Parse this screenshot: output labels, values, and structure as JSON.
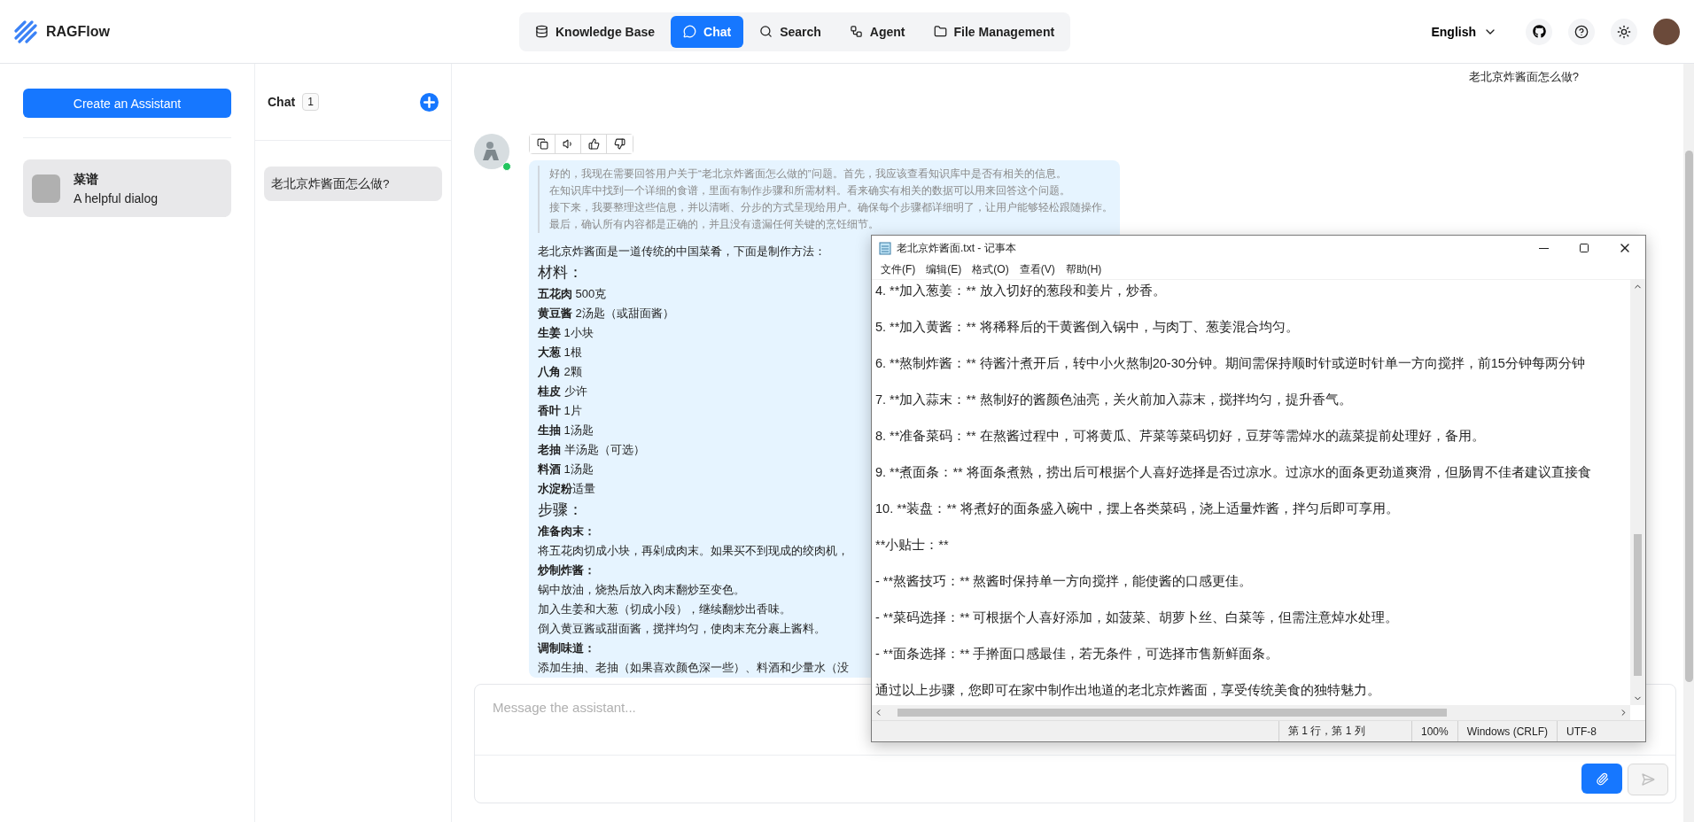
{
  "header": {
    "brand": "RAGFlow",
    "nav": [
      {
        "label": "Knowledge Base",
        "selected": false
      },
      {
        "label": "Chat",
        "selected": true
      },
      {
        "label": "Search",
        "selected": false
      },
      {
        "label": "Agent",
        "selected": false
      },
      {
        "label": "File Management",
        "selected": false
      }
    ],
    "language": "English"
  },
  "assistants_panel": {
    "create_button": "Create an Assistant",
    "assistants": [
      {
        "name": "菜谱",
        "description": "A helpful dialog",
        "selected": true
      }
    ]
  },
  "chats_panel": {
    "title": "Chat",
    "count": "1",
    "conversations": [
      {
        "title": "老北京炸酱面怎么做?",
        "selected": true
      }
    ]
  },
  "conversation": {
    "user_message": "老北京炸酱面怎么做?",
    "assistant": {
      "online": true,
      "thinking": [
        "好的，我现在需要回答用户关于“老北京炸酱面怎么做的”问题。首先，我应该查看知识库中是否有相关的信息。",
        "在知识库中找到一个详细的食谱，里面有制作步骤和所需材料。看来确实有相关的数据可以用来回答这个问题。",
        "接下来，我要整理这些信息，并以清晰、分步的方式呈现给用户。确保每个步骤都详细明了，让用户能够轻松跟随操作。",
        "最后，确认所有内容都是正确的，并且没有遗漏任何关键的烹饪细节。"
      ],
      "answer": [
        {
          "kind": "text",
          "text": "老北京炸酱面是一道传统的中国菜肴，下面是制作方法："
        },
        {
          "kind": "heading",
          "text": "材料："
        },
        {
          "kind": "text",
          "text": "**五花肉** 500克"
        },
        {
          "kind": "text",
          "text": "**黄豆酱** 2汤匙（或甜面酱）"
        },
        {
          "kind": "text",
          "text": "**生姜** 1小块"
        },
        {
          "kind": "text",
          "text": "**大葱** 1根"
        },
        {
          "kind": "text",
          "text": "**八角** 2颗"
        },
        {
          "kind": "text",
          "text": "**桂皮** 少许"
        },
        {
          "kind": "text",
          "text": "**香叶** 1片"
        },
        {
          "kind": "text",
          "text": "**生抽** 1汤匙"
        },
        {
          "kind": "text",
          "text": "**老抽** 半汤匙（可选）"
        },
        {
          "kind": "text",
          "text": "**料酒** 1汤匙"
        },
        {
          "kind": "text",
          "text": "**水淀粉**适量"
        },
        {
          "kind": "heading",
          "text": "步骤："
        },
        {
          "kind": "subheading",
          "text": "准备肉末："
        },
        {
          "kind": "text",
          "text": "将五花肉切成小块，再剁成肉末。如果买不到现成的绞肉机，"
        },
        {
          "kind": "subheading",
          "text": "炒制炸酱："
        },
        {
          "kind": "text",
          "text": "锅中放油，烧热后放入肉末翻炒至变色。"
        },
        {
          "kind": "text",
          "text": "加入生姜和大葱（切成小段），继续翻炒出香味。"
        },
        {
          "kind": "text",
          "text": "倒入黄豆酱或甜面酱，搅拌均匀，使肉末充分裹上酱料。"
        },
        {
          "kind": "subheading",
          "text": "调制味道："
        },
        {
          "kind": "text",
          "text": "添加生抽、老抽（如果喜欢颜色深一些）、料酒和少量水（没"
        }
      ]
    }
  },
  "composer": {
    "placeholder": "Message the assistant...",
    "send_disabled": true
  },
  "notepad": {
    "title": "老北京炸酱面.txt - 记事本",
    "menu": [
      "文件(F)",
      "编辑(E)",
      "格式(O)",
      "查看(V)",
      "帮助(H)"
    ],
    "lines": [
      "4. **加入葱姜：** 放入切好的葱段和姜片，炒香。",
      "5. **加入黄酱：** 将稀释后的干黄酱倒入锅中，与肉丁、葱姜混合均匀。",
      "6. **熬制炸酱：** 待酱汁煮开后，转中小火熬制20-30分钟。期间需保持顺时针或逆时针单一方向搅拌，前15分钟每两分钟",
      "7. **加入蒜末：** 熬制好的酱颜色油亮，关火前加入蒜末，搅拌均匀，提升香气。",
      "8. **准备菜码：** 在熬酱过程中，可将黄瓜、芹菜等菜码切好，豆芽等需焯水的蔬菜提前处理好，备用。",
      "9. **煮面条：** 将面条煮熟，捞出后可根据个人喜好选择是否过凉水。过凉水的面条更劲道爽滑，但肠胃不佳者建议直接食",
      "10. **装盘：** 将煮好的面条盛入碗中，摆上各类菜码，浇上适量炸酱，拌匀后即可享用。",
      "**小贴士：**",
      "- **熬酱技巧：** 熬酱时保持单一方向搅拌，能使酱的口感更佳。",
      "- **菜码选择：** 可根据个人喜好添加，如菠菜、胡萝卜丝、白菜等，但需注意焯水处理。",
      "- **面条选择：** 手擀面口感最佳，若无条件，可选择市售新鲜面条。",
      "通过以上步骤，您即可在家中制作出地道的老北京炸酱面，享受传统美食的独特魅力。"
    ],
    "status": [
      "第 1 行，第 1 列",
      "100%",
      "Windows (CRLF)",
      "UTF-8"
    ]
  }
}
